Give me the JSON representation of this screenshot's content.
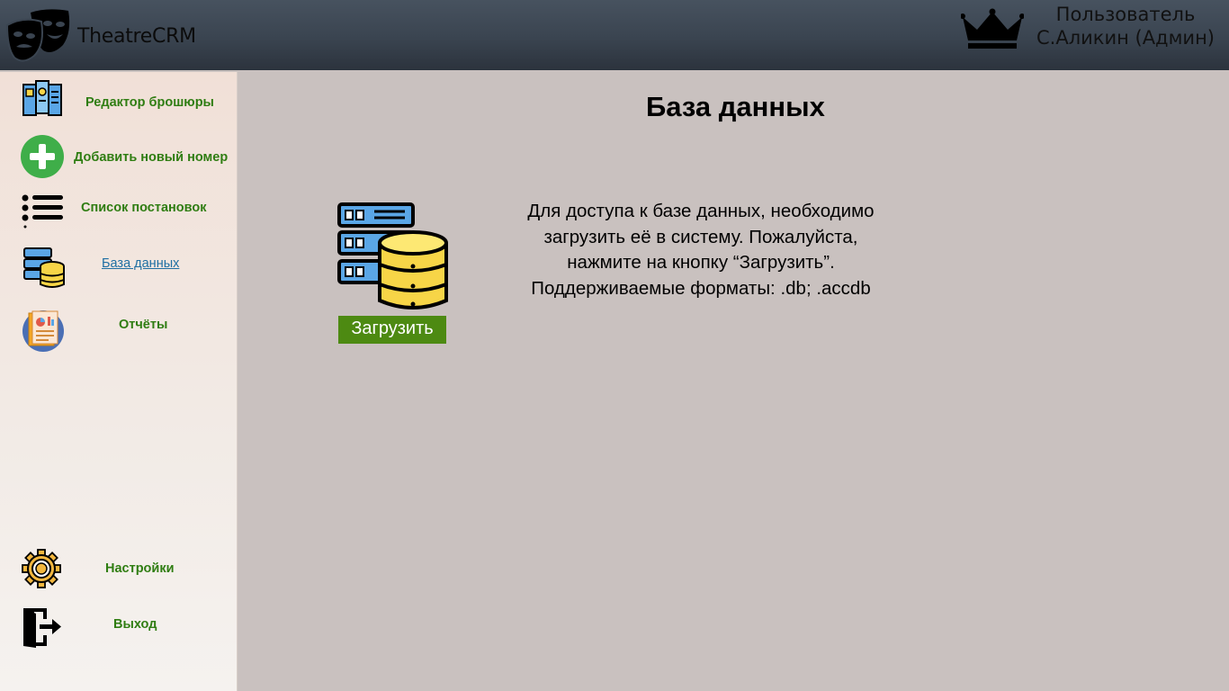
{
  "header": {
    "app_title": "TheatreCRM",
    "user_line1": "Пользователь",
    "user_line2": "С.Аликин (Админ)"
  },
  "sidebar": {
    "items": [
      {
        "label": "Редактор брошюры",
        "icon": "brochure-icon"
      },
      {
        "label": "Добавить новый номер",
        "icon": "plus-circle-icon"
      },
      {
        "label": "Список постановок",
        "icon": "list-icon"
      },
      {
        "label": "База данных",
        "icon": "database-icon",
        "active": true
      },
      {
        "label": "Отчёты",
        "icon": "report-icon"
      },
      {
        "label": "Настройки",
        "icon": "gear-icon"
      },
      {
        "label": "Выход",
        "icon": "exit-door-icon"
      }
    ]
  },
  "main": {
    "title": "База данных",
    "upload_button": "Загрузить",
    "info_lines": [
      "Для доступа к базе данных, необходимо",
      "загрузить её в систему. Пожалуйста,",
      "нажмите на кнопку “Загрузить”.",
      "Поддерживаемые форматы: .db; .accdb"
    ]
  },
  "colors": {
    "header_bg": "#3a4450",
    "sidebar_bg": "#f1e0d7",
    "main_bg": "#c9c1bf",
    "nav_label": "#2f7d12",
    "nav_active": "#1f6fa3",
    "button_bg": "#4d8a12"
  }
}
